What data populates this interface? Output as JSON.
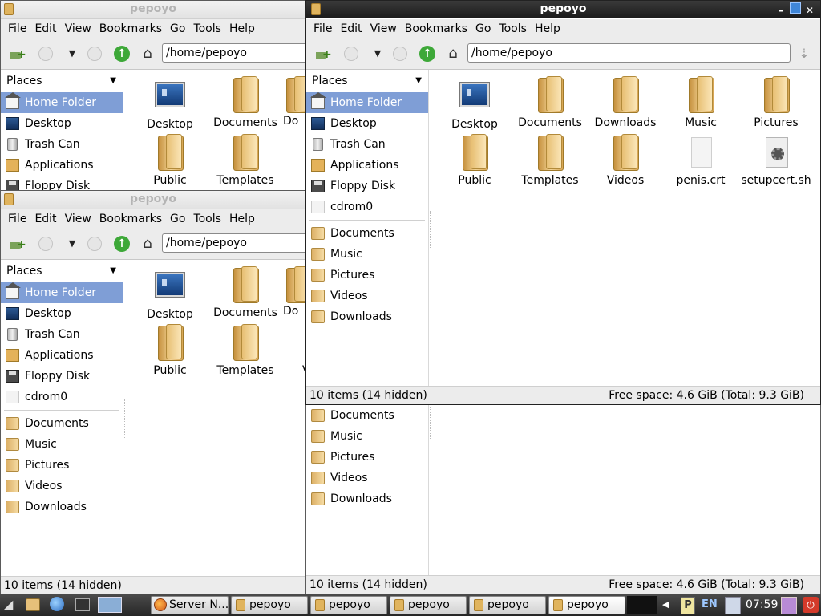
{
  "title": "pepoyo",
  "menu": [
    "File",
    "Edit",
    "View",
    "Bookmarks",
    "Go",
    "Tools",
    "Help"
  ],
  "location": "/home/pepoyo",
  "places": {
    "header": "Places",
    "items": [
      "Home Folder",
      "Desktop",
      "Trash Can",
      "Applications",
      "Floppy Disk",
      "cdrom0"
    ],
    "bookmarks": [
      "Documents",
      "Music",
      "Pictures",
      "Videos",
      "Downloads"
    ]
  },
  "files": [
    "Desktop",
    "Documents",
    "Downloads",
    "Music",
    "Pictures",
    "Public",
    "Templates",
    "Videos",
    "penis.crt",
    "setupcert.sh"
  ],
  "clipped": {
    "documents_partial": "Do",
    "v_partial": "V"
  },
  "status": {
    "items": "10 items (14 hidden)",
    "free_space": "Free space: 4.6 GiB (Total: 9.3 GiB)"
  },
  "taskbar": {
    "tasks": [
      "Server N...",
      "pepoyo",
      "pepoyo",
      "pepoyo",
      "pepoyo",
      "pepoyo"
    ],
    "lang": "EN",
    "clock": "07:59"
  },
  "colors": {
    "selection": "#7f9ed6",
    "titlebar_active": "#1a1a1a",
    "taskbar": "#262626"
  }
}
